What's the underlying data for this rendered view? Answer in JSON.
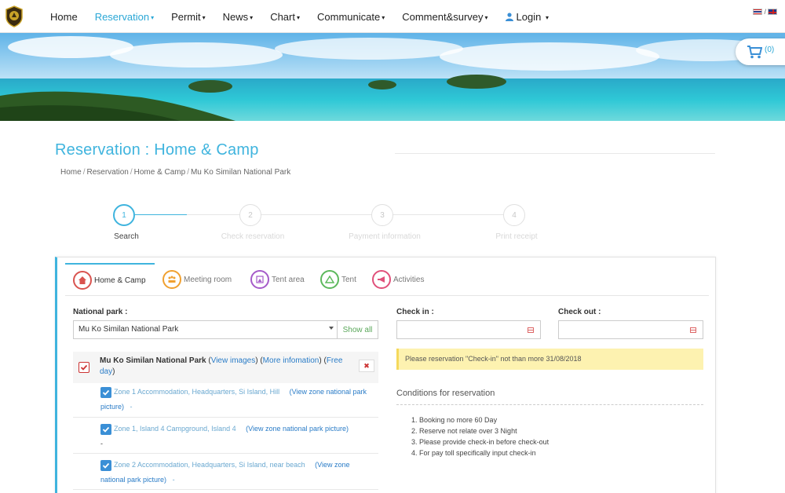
{
  "nav": {
    "menu": [
      {
        "label": "Home",
        "has_caret": false,
        "active": false
      },
      {
        "label": "Reservation",
        "has_caret": true,
        "active": true
      },
      {
        "label": "Permit",
        "has_caret": true,
        "active": false
      },
      {
        "label": "News",
        "has_caret": true,
        "active": false
      },
      {
        "label": "Chart",
        "has_caret": true,
        "active": false
      },
      {
        "label": "Communicate",
        "has_caret": true,
        "active": false
      },
      {
        "label": "Comment&survey",
        "has_caret": true,
        "active": false
      }
    ],
    "login_label": "Login",
    "lang_separator": "/",
    "icons": {
      "logo": "park-emblem-logo",
      "user": "user-icon",
      "caret": "caret-down-icon",
      "flag_th": "thai-flag-icon",
      "flag_en": "uk-flag-icon"
    }
  },
  "cart": {
    "count_text": "(0)",
    "icon": "cart-icon"
  },
  "page": {
    "title": "Reservation : Home & Camp",
    "breadcrumb": [
      "Home",
      "Reservation",
      "Home & Camp",
      "Mu Ko Similan National Park"
    ]
  },
  "steps": [
    {
      "number": "1",
      "label": "Search",
      "active": true
    },
    {
      "number": "2",
      "label": "Check reservation",
      "active": false
    },
    {
      "number": "3",
      "label": "Payment information",
      "active": false
    },
    {
      "number": "4",
      "label": "Print receipt",
      "active": false
    }
  ],
  "tabs": [
    {
      "label": "Home & Camp",
      "icon": "home-icon",
      "color": "#d9534f",
      "active": true
    },
    {
      "label": "Meeting room",
      "icon": "meeting-icon",
      "color": "#f0a030",
      "active": false
    },
    {
      "label": "Tent area",
      "icon": "tent-area-icon",
      "color": "#a55ac9",
      "active": false
    },
    {
      "label": "Tent",
      "icon": "tent-icon",
      "color": "#5cb85c",
      "active": false
    },
    {
      "label": "Activities",
      "icon": "megaphone-icon",
      "color": "#e0507a",
      "active": false
    }
  ],
  "form": {
    "national_park_label": "National park :",
    "national_park_value": "Mu Ko Similan National Park",
    "show_all_label": "Show all",
    "check_in_label": "Check in :",
    "check_out_label": "Check out :",
    "check_in_value": "",
    "check_out_value": ""
  },
  "park": {
    "name": "Mu Ko Similan National Park",
    "view_images": "View images",
    "more_info": "More infomation",
    "free_day": "Free day",
    "remove_symbol": "✖"
  },
  "zones": [
    {
      "name": "Zone 1 Accommodation, Headquarters, Si Island, Hill",
      "link": "(View zone national park picture)",
      "dash": "-"
    },
    {
      "name": "Zone 1, Island 4 Campground, Island 4",
      "link": "(View zone national park picture)",
      "dash": "-"
    },
    {
      "name": "Zone 2 Accommodation, Headquarters, Si Island, near beach",
      "link": "(View zone national park picture)",
      "dash": "-"
    }
  ],
  "notice": "Please reservation \"Check-in\" not than more 31/08/2018",
  "conditions": {
    "title": "Conditions for reservation",
    "items": [
      "1. Booking no more 60 Day",
      "2. Reserve not relate over 3 Night",
      "3. Please provide check-in before check-out",
      "4. For pay toll specifically input check-in"
    ]
  },
  "colors": {
    "accent": "#3fb4de",
    "link": "#2a7cc7",
    "notice_bg": "#fdf2b0",
    "danger": "#cc3333",
    "success": "#5aa75a"
  }
}
